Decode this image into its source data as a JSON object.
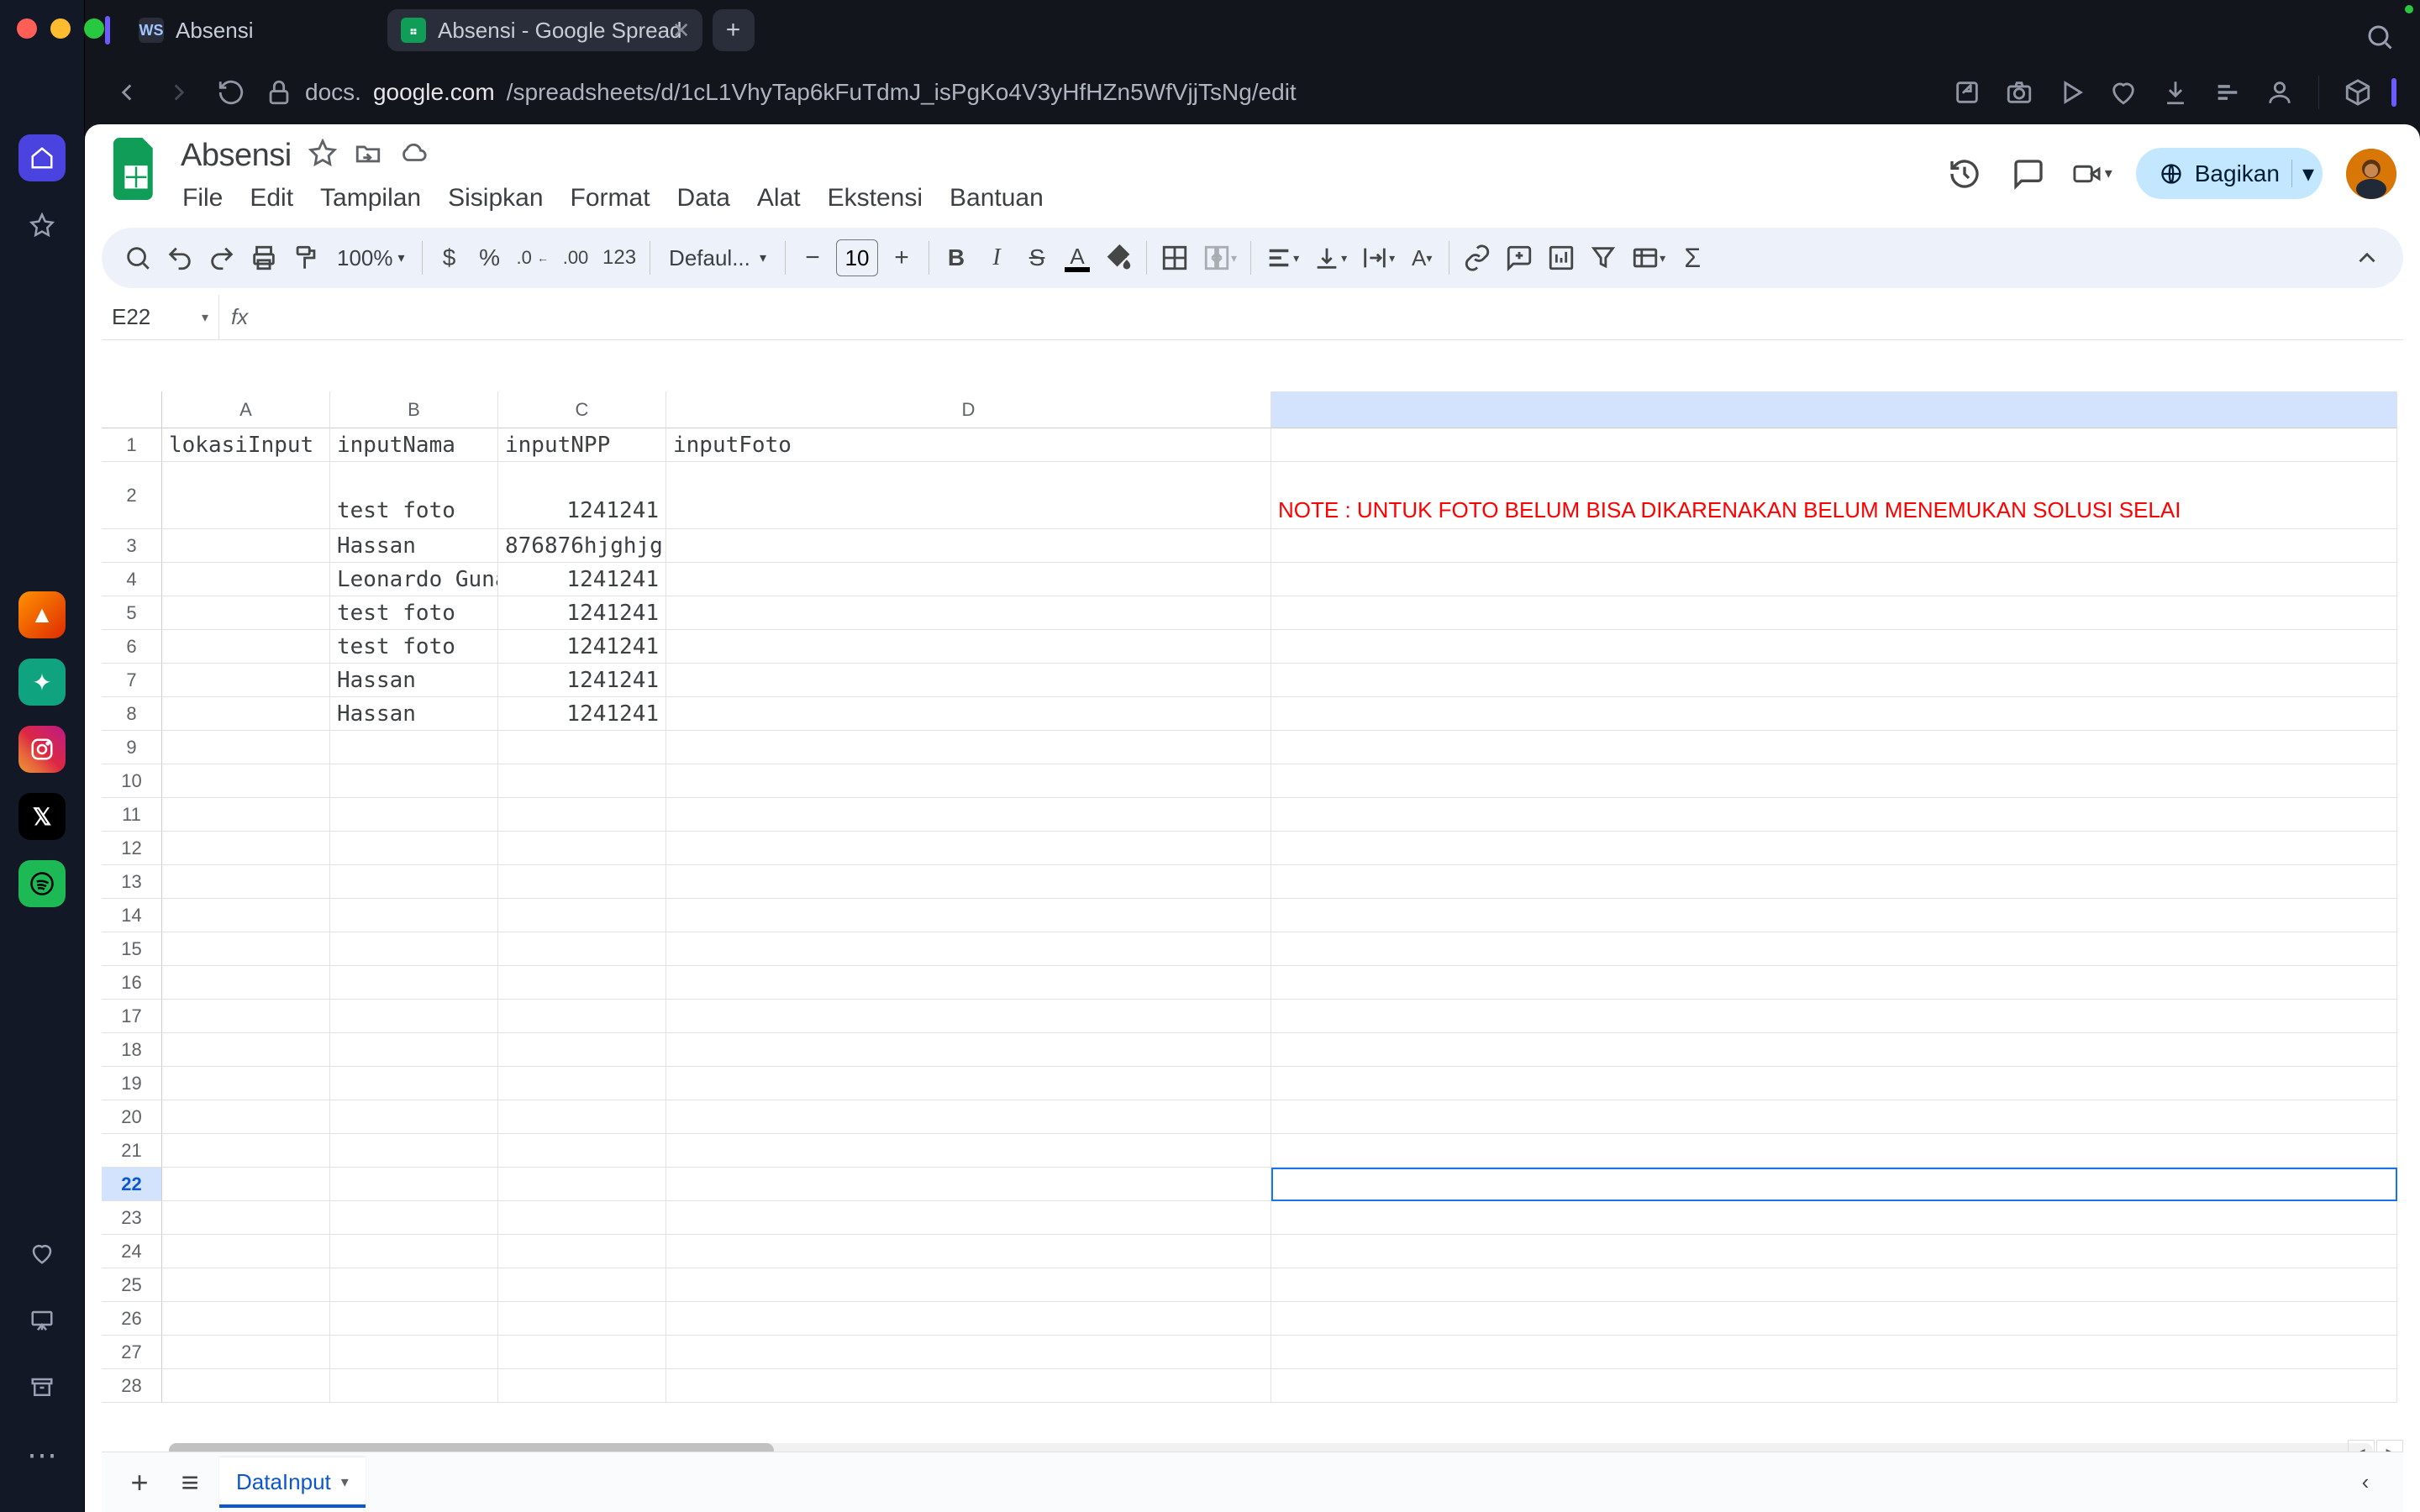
{
  "os": {
    "tabs": [
      {
        "title": "Absensi",
        "favicon": "WS",
        "active": false
      },
      {
        "title": "Absensi - Google Spread",
        "favicon": "sheets",
        "active": true
      }
    ]
  },
  "browser": {
    "url_prefix": "docs.",
    "url_domain": "google.com",
    "url_path": "/spreadsheets/d/1cL1VhyTap6kFuTdmJ_isPgKo4V3yHfHZn5WfVjjTsNg/edit"
  },
  "sheets": {
    "doc_title": "Absensi",
    "menus": [
      "File",
      "Edit",
      "Tampilan",
      "Sisipkan",
      "Format",
      "Data",
      "Alat",
      "Ekstensi",
      "Bantuan"
    ],
    "share_label": "Bagikan",
    "zoom": "100%",
    "font_name": "Defaul...",
    "font_size": "10",
    "namebox": "E22",
    "formula": "",
    "sheet_tab": "DataInput",
    "columns": [
      "A",
      "B",
      "C",
      "D",
      ""
    ],
    "rows": [
      {
        "n": "1",
        "A": "lokasiInput",
        "B": "inputNama",
        "C": "inputNPP",
        "D": "inputFoto",
        "E": ""
      },
      {
        "n": "2",
        "A": "",
        "B": "test foto",
        "C": "1241241",
        "C_align": "r",
        "D": "",
        "E": "NOTE : UNTUK FOTO BELUM BISA DIKARENAKAN BELUM MENEMUKAN SOLUSI SELAI",
        "E_red": true,
        "tall": true
      },
      {
        "n": "3",
        "A": "",
        "B": "Hassan",
        "C": "876876hjghjg",
        "D": "",
        "E": ""
      },
      {
        "n": "4",
        "A": "",
        "B": "Leonardo Gunav",
        "C": "1241241",
        "C_align": "r",
        "D": "",
        "E": ""
      },
      {
        "n": "5",
        "A": "",
        "B": "test foto",
        "C": "1241241",
        "C_align": "r",
        "D": "",
        "E": ""
      },
      {
        "n": "6",
        "A": "",
        "B": "test foto",
        "C": "1241241",
        "C_align": "r",
        "D": "",
        "E": ""
      },
      {
        "n": "7",
        "A": "",
        "B": "Hassan",
        "C": "1241241",
        "C_align": "r",
        "D": "",
        "E": ""
      },
      {
        "n": "8",
        "A": "",
        "B": "Hassan",
        "C": "1241241",
        "C_align": "r",
        "D": "",
        "E": ""
      },
      {
        "n": "9",
        "A": "",
        "B": "",
        "C": "",
        "D": "",
        "E": ""
      },
      {
        "n": "10",
        "A": "",
        "B": "",
        "C": "",
        "D": "",
        "E": ""
      },
      {
        "n": "11",
        "A": "",
        "B": "",
        "C": "",
        "D": "",
        "E": ""
      },
      {
        "n": "12",
        "A": "",
        "B": "",
        "C": "",
        "D": "",
        "E": ""
      },
      {
        "n": "13",
        "A": "",
        "B": "",
        "C": "",
        "D": "",
        "E": ""
      },
      {
        "n": "14",
        "A": "",
        "B": "",
        "C": "",
        "D": "",
        "E": ""
      },
      {
        "n": "15",
        "A": "",
        "B": "",
        "C": "",
        "D": "",
        "E": ""
      },
      {
        "n": "16",
        "A": "",
        "B": "",
        "C": "",
        "D": "",
        "E": ""
      },
      {
        "n": "17",
        "A": "",
        "B": "",
        "C": "",
        "D": "",
        "E": ""
      },
      {
        "n": "18",
        "A": "",
        "B": "",
        "C": "",
        "D": "",
        "E": ""
      },
      {
        "n": "19",
        "A": "",
        "B": "",
        "C": "",
        "D": "",
        "E": ""
      },
      {
        "n": "20",
        "A": "",
        "B": "",
        "C": "",
        "D": "",
        "E": ""
      },
      {
        "n": "21",
        "A": "",
        "B": "",
        "C": "",
        "D": "",
        "E": ""
      },
      {
        "n": "22",
        "A": "",
        "B": "",
        "C": "",
        "D": "",
        "E": "",
        "selectedE": true
      },
      {
        "n": "23",
        "A": "",
        "B": "",
        "C": "",
        "D": "",
        "E": ""
      },
      {
        "n": "24",
        "A": "",
        "B": "",
        "C": "",
        "D": "",
        "E": ""
      },
      {
        "n": "25",
        "A": "",
        "B": "",
        "C": "",
        "D": "",
        "E": ""
      },
      {
        "n": "26",
        "A": "",
        "B": "",
        "C": "",
        "D": "",
        "E": ""
      },
      {
        "n": "27",
        "A": "",
        "B": "",
        "C": "",
        "D": "",
        "E": ""
      },
      {
        "n": "28",
        "A": "",
        "B": "",
        "C": "",
        "D": "",
        "E": ""
      }
    ]
  }
}
